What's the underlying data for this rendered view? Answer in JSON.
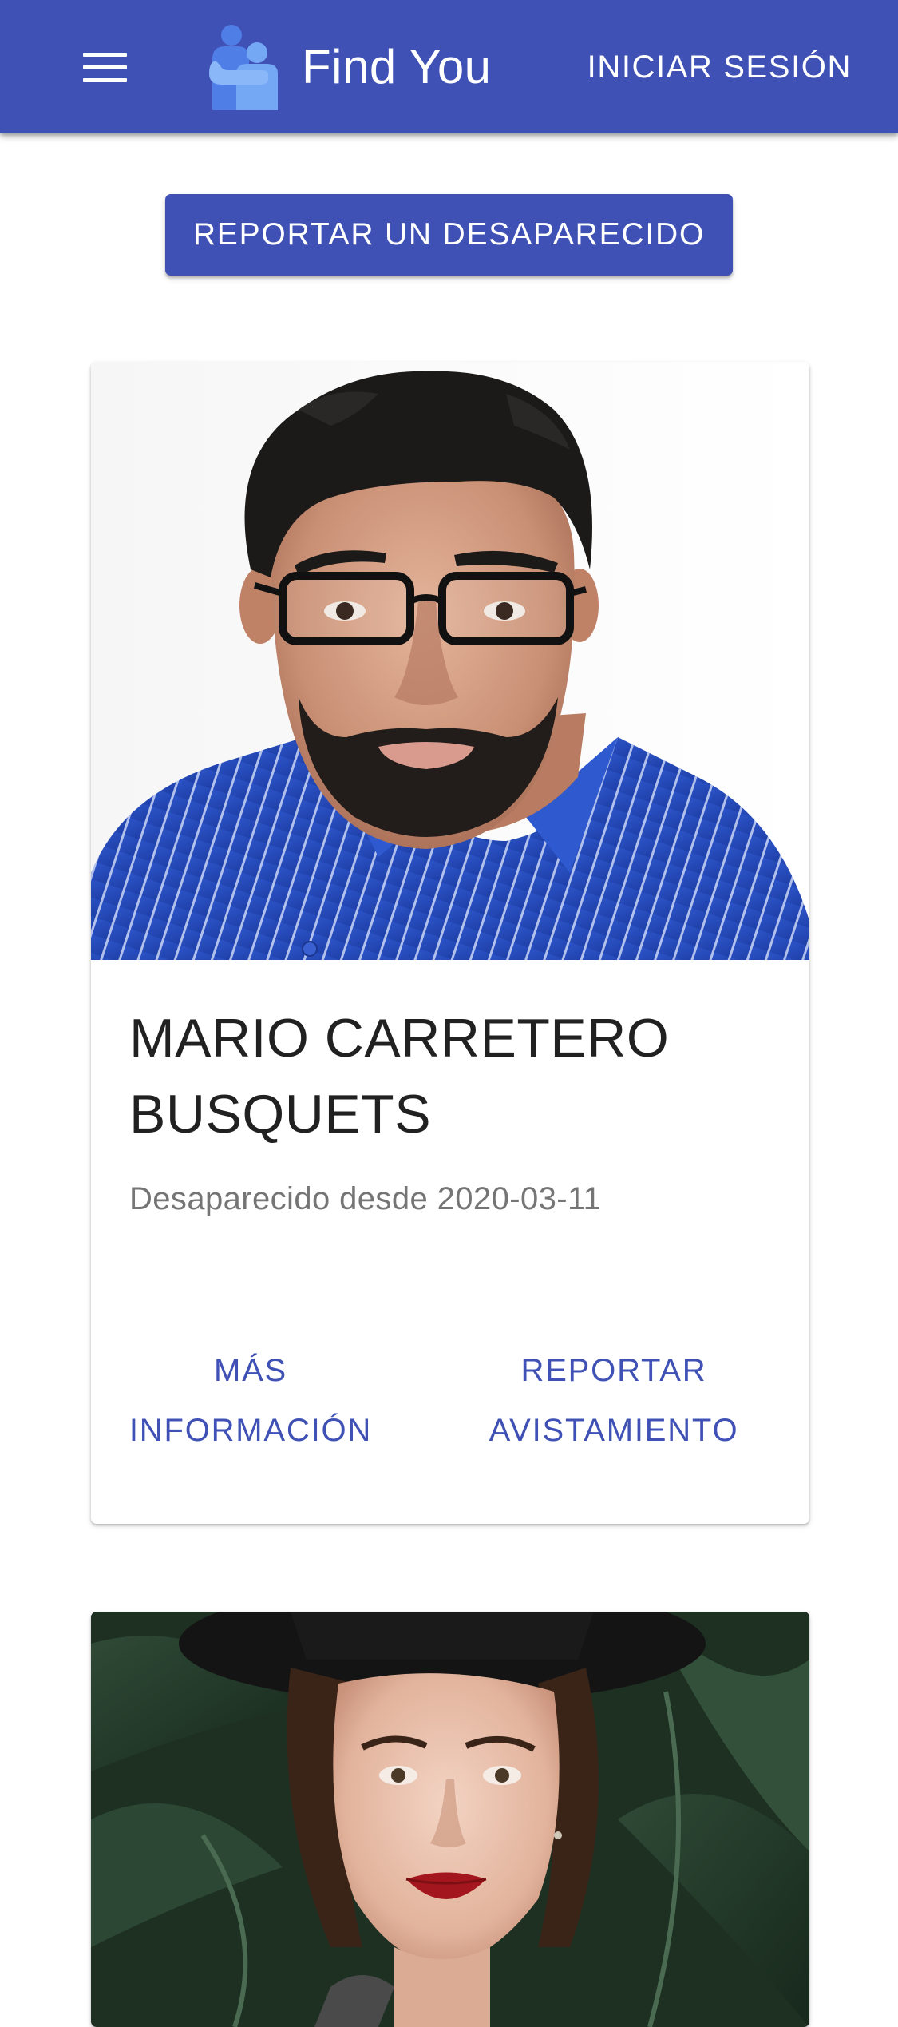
{
  "app": {
    "title": "Find You",
    "login_label": "INICIAR SESIÓN",
    "colors": {
      "primary": "#3f51b5",
      "logo_dark": "#4f7fe6",
      "logo_light": "#74a8f5"
    },
    "icons": {
      "menu": "hamburger-menu-icon",
      "logo": "hug-logo-icon"
    }
  },
  "main": {
    "report_button_label": "REPORTAR UN DESAPARECIDO"
  },
  "cards": [
    {
      "name_line1": "MARIO CARRETERO",
      "name_line2": "BUSQUETS",
      "missing_label": "Desaparecido desde",
      "missing_date": "2020-03-11",
      "more_info_line1": "MÁS",
      "more_info_line2": "INFORMACIÓN",
      "sighting_line1": "REPORTAR",
      "sighting_line2": "AVISTAMIENTO"
    },
    {
      "photo": "portrait-woman-black-hat"
    }
  ]
}
